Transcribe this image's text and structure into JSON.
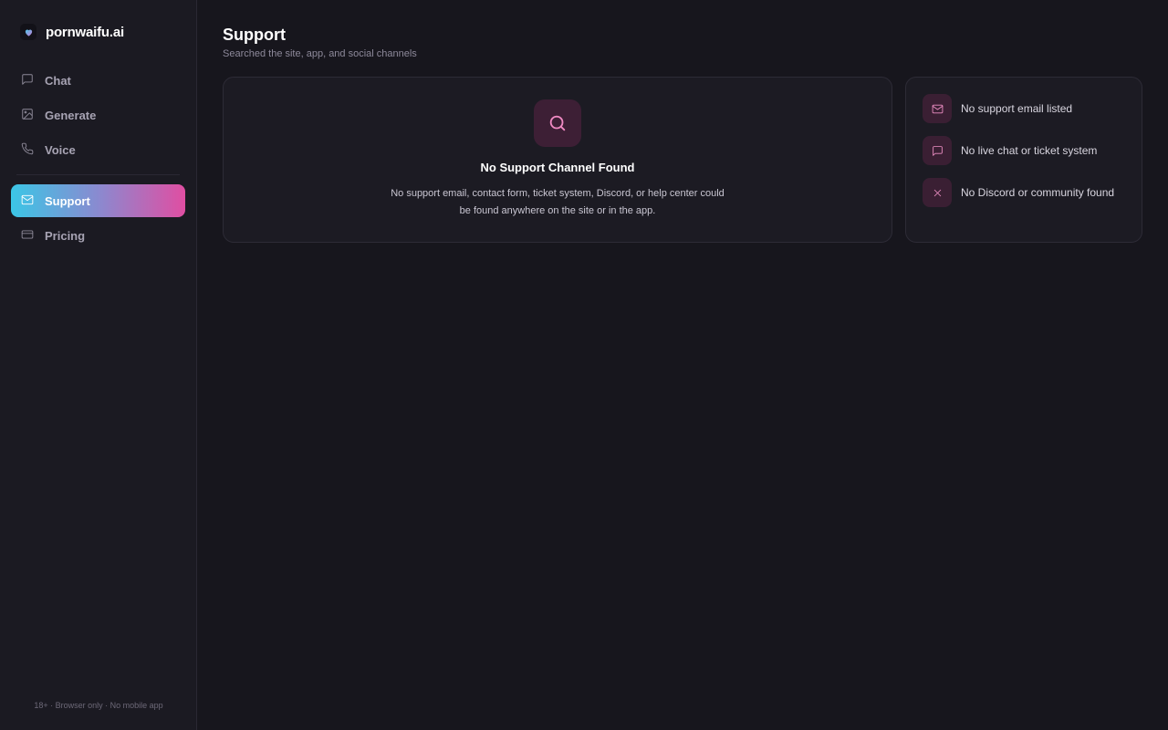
{
  "brand": {
    "name": "pornwaifu.ai",
    "icon": "heart-icon"
  },
  "sidebar": {
    "items": [
      {
        "label": "Chat",
        "icon": "message-square-icon"
      },
      {
        "label": "Generate",
        "icon": "image-icon"
      },
      {
        "label": "Voice",
        "icon": "phone-icon"
      },
      {
        "label": "Support",
        "icon": "mail-icon",
        "active": true
      },
      {
        "label": "Pricing",
        "icon": "credit-card-icon"
      }
    ],
    "footer": "18+ · Browser only · No mobile app"
  },
  "page": {
    "title": "Support",
    "subtitle": "Searched the site, app, and social channels"
  },
  "main_card": {
    "icon": "search-icon",
    "title": "No Support Channel Found",
    "description": "No support email, contact form, ticket system, Discord, or help center could be found anywhere on the site or in the app."
  },
  "side_card": {
    "items": [
      {
        "icon": "mail-icon",
        "label": "No support email listed"
      },
      {
        "icon": "message-square-icon",
        "label": "No live chat or ticket system"
      },
      {
        "icon": "x-icon",
        "label": "No Discord or community found"
      }
    ]
  },
  "colors": {
    "accent_gradient_start": "#3bc6e6",
    "accent_gradient_end": "#e04ea2",
    "icon_accent": "#f08ac3",
    "background": "#17161d"
  }
}
